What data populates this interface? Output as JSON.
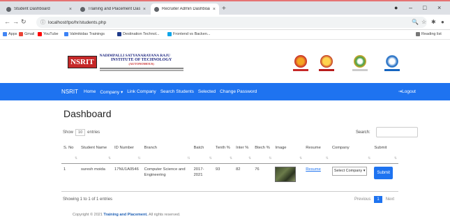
{
  "browser": {
    "tabs": [
      {
        "title": "Student Dashboard"
      },
      {
        "title": "Training and Placement Dashbo..."
      },
      {
        "title": "Recruiter Admin Dashboard"
      }
    ],
    "url": "localhost/tpo/hr/students.php",
    "bookmarks": [
      "Apps",
      "Gmail",
      "YouTube",
      "Valmikidas Trainings",
      "Destination Technol...",
      "Frontend vs Backen..."
    ],
    "reading_list": "Reading list"
  },
  "header": {
    "logo_abbr": "NSRIT",
    "college_line1": "NADIMPALLI SATYANARAYANA RAJU",
    "college_line2": "INSTITUTE OF TECHNOLOGY",
    "college_line3": "(AUTONOMOUS)"
  },
  "navbar": {
    "brand": "NSRIT",
    "items": [
      "Home",
      "Company",
      "Link Company",
      "Search Students",
      "Selected",
      "Change Password"
    ],
    "logout": "Logout"
  },
  "dashboard": {
    "title": "Dashboard",
    "show_label": "Show",
    "entries_value": "10",
    "entries_label": "entries",
    "search_label": "Search:",
    "search_value": "",
    "columns": [
      "S. No",
      "Student Name",
      "ID Number",
      "Branch",
      "Batch",
      "Tenth %",
      "Inter %",
      "Btech %",
      "Image",
      "Resume",
      "Company",
      "Submit"
    ],
    "rows": [
      {
        "sno": "1",
        "name": "suresh moida",
        "id": "17NU1A0546",
        "branch": "Computer Science and Engineering",
        "batch": "2017-2021",
        "tenth": "93",
        "inter": "82",
        "btech": "76",
        "resume": "Resume",
        "company_select": "Select Company",
        "submit": "Submit"
      }
    ],
    "showing": "Showing 1 to 1 of 1 entries",
    "pager": {
      "prev": "Previous",
      "page": "1",
      "next": "Next"
    }
  },
  "footer": {
    "prefix": "Copyright © 2021",
    "link": "Training and Placement.",
    "suffix": "All rights reserved."
  },
  "colors": {
    "navbar": "#1e73f0",
    "logo_red": "#c62828"
  }
}
